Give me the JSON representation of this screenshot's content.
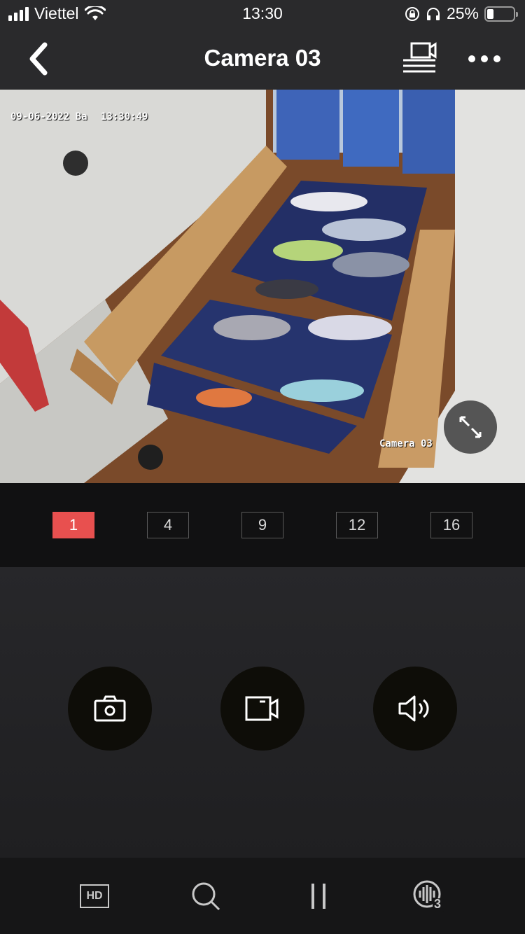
{
  "status_bar": {
    "carrier": "Viettel",
    "time": "13:30",
    "battery": "25%",
    "battery_level": 0.25
  },
  "nav": {
    "title": "Camera 03"
  },
  "video": {
    "timestamp_date": "09-06-2022 Ba",
    "timestamp_time": "13:30:49",
    "camera_label": "Camera 03"
  },
  "split_options": [
    "1",
    "4",
    "9",
    "12",
    "16"
  ],
  "toolbar": {
    "hd_label": "HD",
    "voice_badge": "3"
  },
  "colors": {
    "accent": "#e8504f",
    "background": "#1c1c1e",
    "header": "#2a2a2c"
  }
}
